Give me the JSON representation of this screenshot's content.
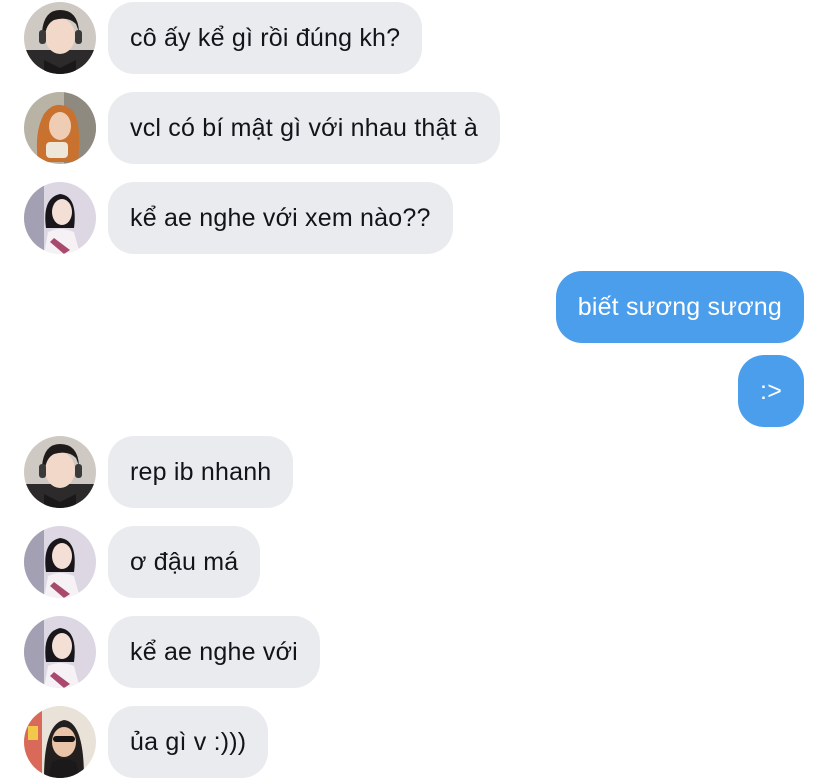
{
  "messages": [
    {
      "from": "avatar-girl-headphones",
      "direction": "in",
      "text": "cô ấy kể gì rồi đúng kh?"
    },
    {
      "from": "avatar-girl-orange-hair",
      "direction": "in",
      "text": "vcl có bí mật gì với nhau thật à"
    },
    {
      "from": "avatar-girl-guitar",
      "direction": "in",
      "text": "kể ae nghe với xem nào??"
    },
    {
      "from": "me",
      "direction": "out",
      "text": "biết sương sương"
    },
    {
      "from": "me",
      "direction": "out",
      "text": ":>"
    },
    {
      "from": "avatar-girl-headphones",
      "direction": "in",
      "text": "rep ib nhanh"
    },
    {
      "from": "avatar-girl-guitar",
      "direction": "in",
      "text": "ơ đậu má"
    },
    {
      "from": "avatar-girl-guitar",
      "direction": "in",
      "text": "kể ae nghe với"
    },
    {
      "from": "avatar-girl-sunglasses",
      "direction": "in",
      "text": "ủa gì v :)))"
    }
  ],
  "colors": {
    "incoming_bubble": "#e9ebef",
    "outgoing_bubble": "#4a9eec",
    "incoming_text": "#111418",
    "outgoing_text": "#ffffff"
  }
}
